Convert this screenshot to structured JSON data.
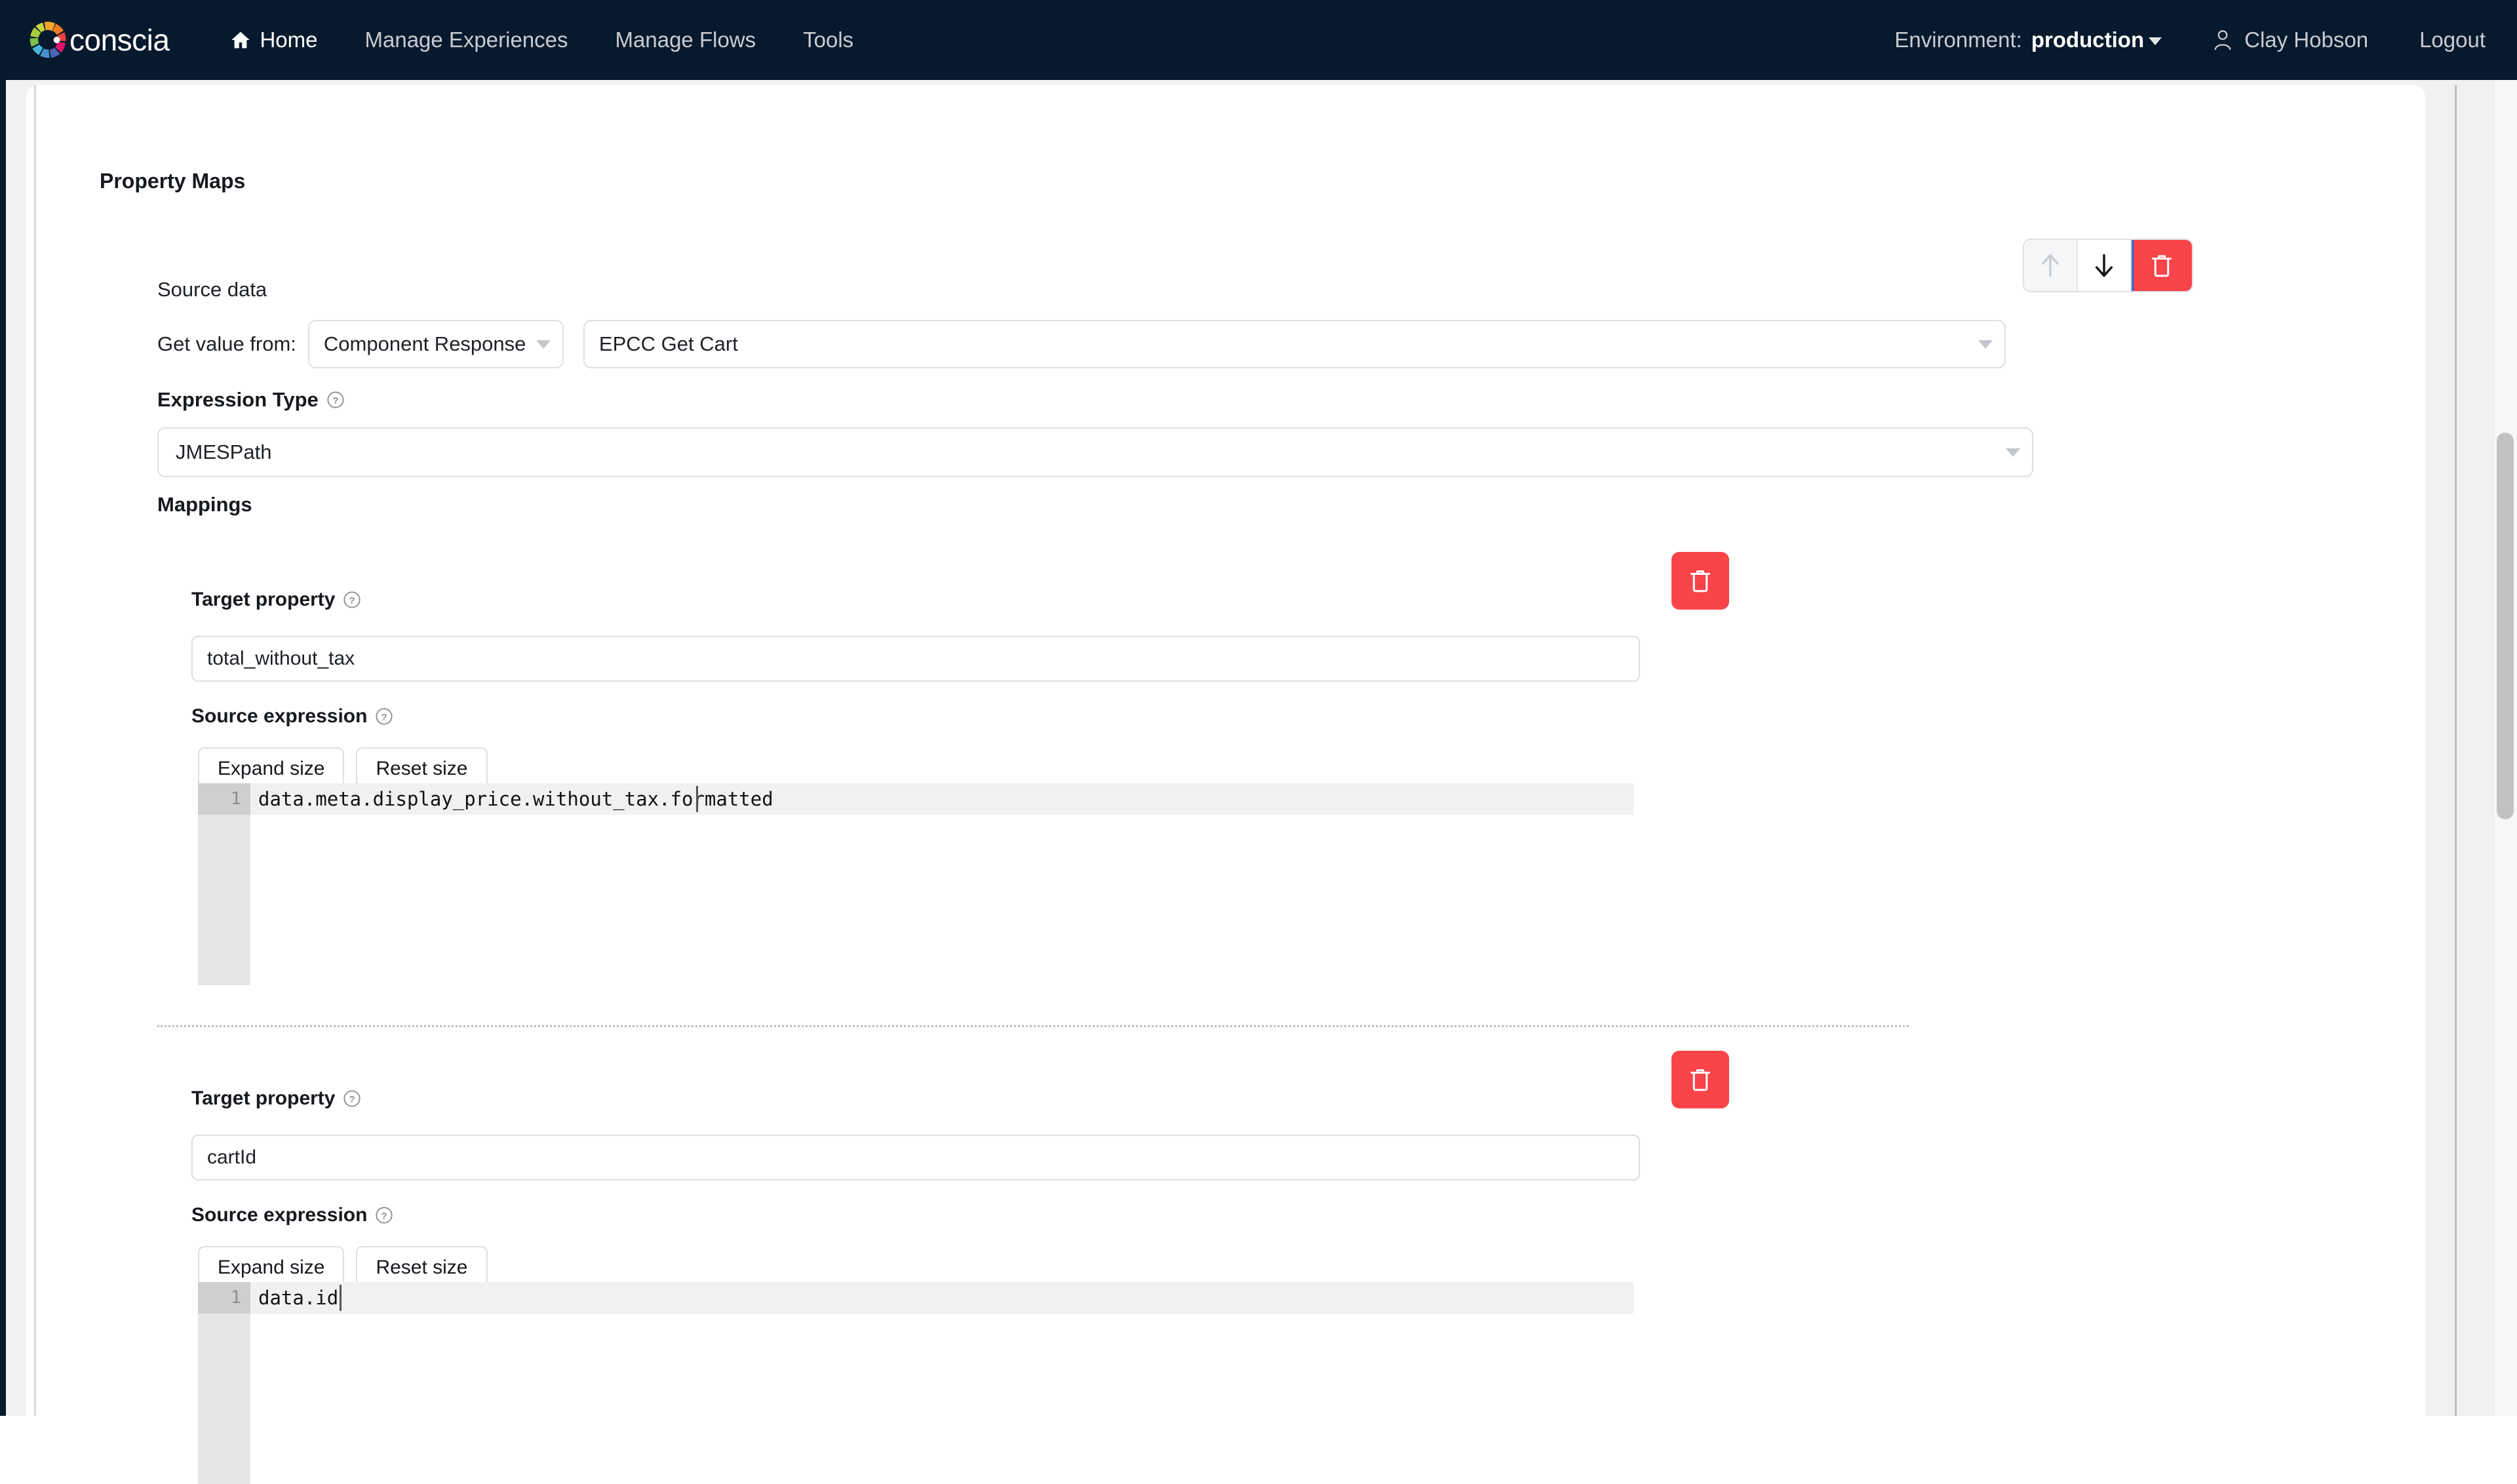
{
  "navbar": {
    "brand": "conscia",
    "links": [
      {
        "label": "Home",
        "icon": "home-icon",
        "active": true
      },
      {
        "label": "Manage Experiences",
        "icon": "",
        "active": false
      },
      {
        "label": "Manage Flows",
        "icon": "",
        "active": false
      },
      {
        "label": "Tools",
        "icon": "",
        "active": false
      }
    ],
    "environment_label": "Environment:",
    "environment_value": "production",
    "user_name": "Clay Hobson",
    "logout_label": "Logout"
  },
  "page": {
    "section_title": "Property Maps",
    "source_data_label": "Source data",
    "get_value_from_label": "Get value from:",
    "source_kind": "Component Response",
    "source_component": "EPCC Get Cart",
    "expression_type_label": "Expression Type",
    "expression_type_value": "JMESPath",
    "mappings_label": "Mappings"
  },
  "toolbar": {
    "move_up": "move-up",
    "move_down": "move-down",
    "delete": "delete"
  },
  "mappings": [
    {
      "target_property_label": "Target property",
      "target_property_value": "total_without_tax",
      "source_expression_label": "Source expression",
      "expand_size_label": "Expand size",
      "reset_size_label": "Reset size",
      "line_number": "1",
      "expression": "data.meta.display_price.without_tax.formatted"
    },
    {
      "target_property_label": "Target property",
      "target_property_value": "cartId",
      "source_expression_label": "Source expression",
      "expand_size_label": "Expand size",
      "reset_size_label": "Reset size",
      "line_number": "1",
      "expression": "data.id"
    }
  ],
  "colors": {
    "nav_bg": "#07192c",
    "danger": "#f9444a",
    "page_bg": "#f1f1f1",
    "border": "#dcdfe3"
  }
}
